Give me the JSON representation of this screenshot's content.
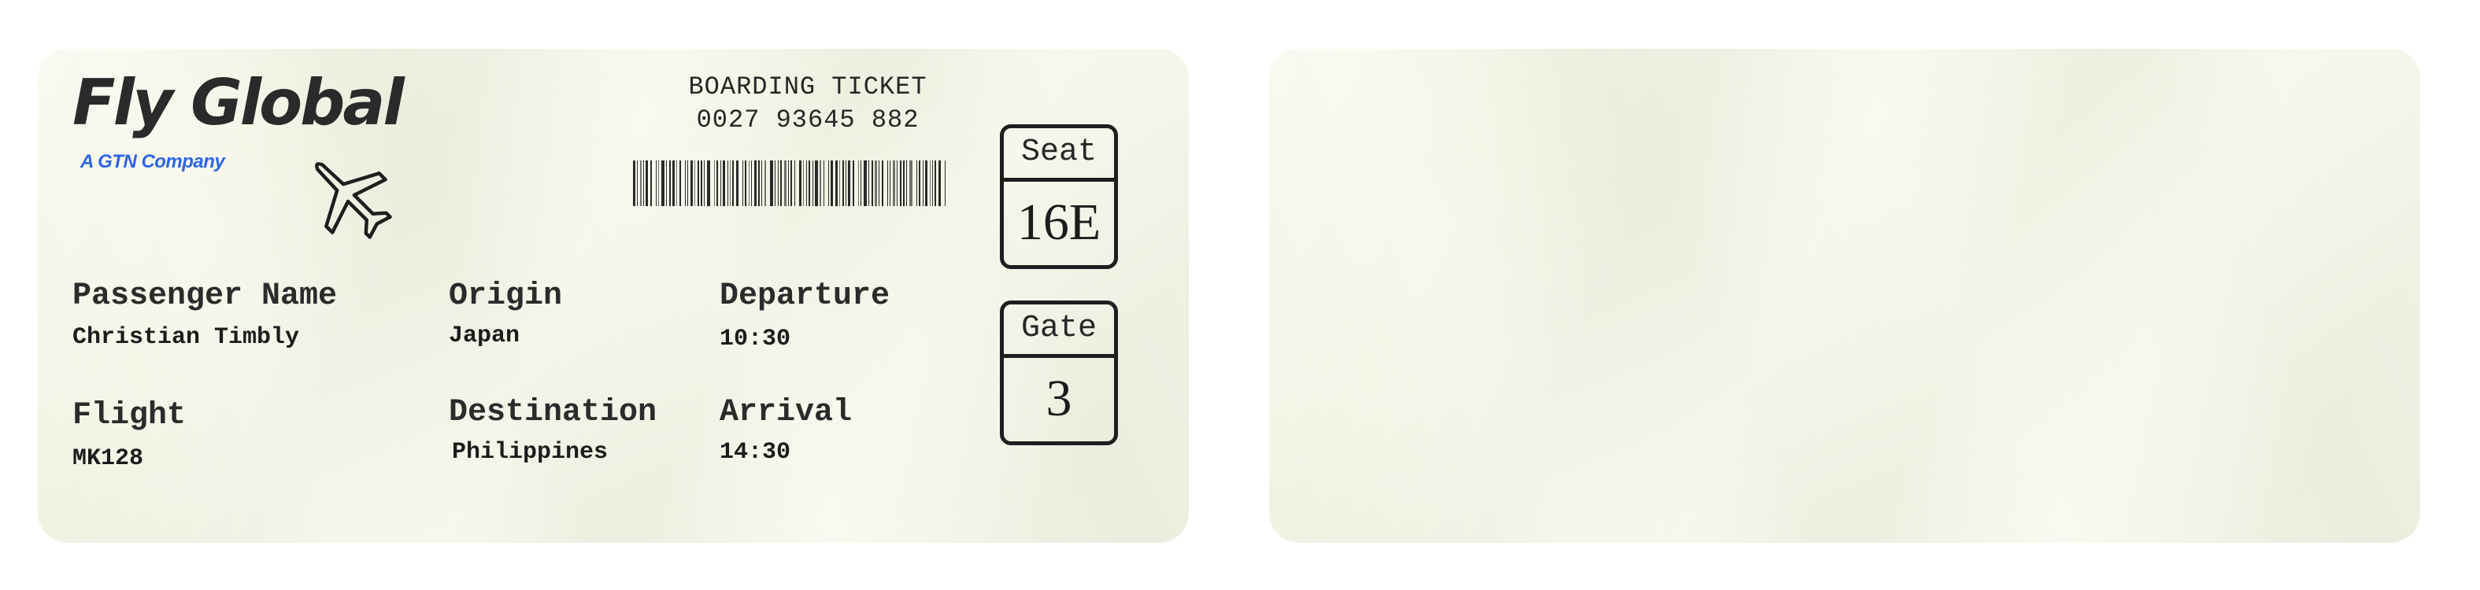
{
  "brand": {
    "name": "Fly Global",
    "tagline": "A GTN Company"
  },
  "ticket": {
    "title": "BOARDING TICKET",
    "number": "0027 93645 882",
    "passenger_label": "Passenger Name",
    "passenger_value": "Christian Timbly",
    "flight_label": "Flight",
    "flight_value": "MK128",
    "origin_label": "Origin",
    "origin_value": "Japan",
    "destination_label": "Destination",
    "destination_value": "Philippines",
    "departure_label": "Departure",
    "departure_value": "10:30",
    "arrival_label": "Arrival",
    "arrival_value": "14:30",
    "seat_label": "Seat",
    "seat_value": "16E",
    "gate_label": "Gate",
    "gate_value": "3"
  },
  "icons": {
    "plane": "airplane-icon",
    "barcode": "barcode-icon"
  },
  "colors": {
    "paper": "#f5f5e6",
    "ink": "#262626",
    "brand_accent": "#2f66e6"
  }
}
